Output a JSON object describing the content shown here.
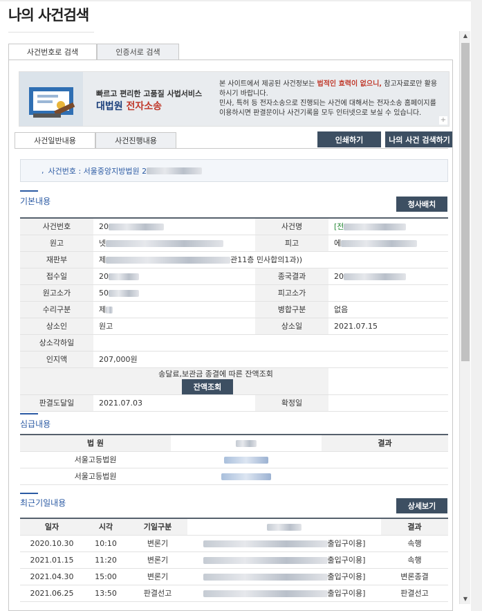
{
  "page_title": "나의 사건검색",
  "tabs_top": [
    "사건번호로 검색",
    "인증서로 검색"
  ],
  "banner": {
    "slogan": "빠르고 편리한 고품질 사법서비스",
    "brand_a": "대법원 ",
    "brand_b": "전자소송",
    "note_1": "본 사이트에서 제공된 사건정보는 ",
    "note_hl": "법적인 효력이 없으니,",
    "note_2": " 참고자료로만 활용하시기 바랍니다.",
    "note_3": "민사, 특허 등 전자소송으로 진행되는 사건에 대해서는 전자소송 홈페이지를 이용하시면 판결문이나 사건기록을 모두 인터넷으로 보실 수 있습니다.",
    "plus": "+"
  },
  "tabs_inner": [
    "사건일반내용",
    "사건진행내용"
  ],
  "buttons": {
    "print": "인쇄하기",
    "my_case": "나의 사건 검색하기",
    "claim": "청사배치",
    "balance": "잔액조회",
    "detail": "상세보기"
  },
  "case_box": {
    "prefix": ",",
    "text": "사건번호 : 서울중앙지방법원 2"
  },
  "sections": {
    "basic": "기본내용",
    "trial": "심급내용",
    "recent": "최근기일내용"
  },
  "basic": {
    "r1": {
      "l1": "사건번호",
      "v1": "20",
      "l2": "사건명",
      "v2": "[전"
    },
    "r2": {
      "l1": "원고",
      "v1": "넷",
      "l2": "피고",
      "v2": "에"
    },
    "r3": {
      "l1": "재판부",
      "v1": "제",
      "tail": "관11층 민사합의1과))"
    },
    "r4": {
      "l1": "접수일",
      "v1": "20",
      "l2": "종국결과",
      "v2": "20"
    },
    "r5": {
      "l1": "원고소가",
      "v1": "50",
      "l2": "피고소가",
      "v2": ""
    },
    "r6": {
      "l1": "수리구분",
      "v1": "제",
      "l2": "병합구분",
      "v2": "없음"
    },
    "r7": {
      "l1": "상소인",
      "v1": "원고",
      "l2": "상소일",
      "v2": "2021.07.15"
    },
    "r8": {
      "l1": "상소각하일",
      "v1": ""
    },
    "r9": {
      "l1": "인지액",
      "v1": "207,000원"
    },
    "r10": {
      "l1": "송달료,보관금 종결에 따른 잔액조회"
    },
    "r11": {
      "l1": "판결도달일",
      "v1": "2021.07.03",
      "l2": "확정일",
      "v2": ""
    }
  },
  "trial": {
    "headers": [
      "법 원",
      "",
      "결과"
    ],
    "rows": [
      {
        "court": "서울고등법원"
      },
      {
        "court": "서울고등법원"
      }
    ]
  },
  "recent": {
    "headers": [
      "일자",
      "시각",
      "기일구분",
      "장소",
      "결과"
    ],
    "rows": [
      {
        "date": "2020.10.30",
        "time": "10:10",
        "kind": "변론기",
        "place_tail": "출입구이용]",
        "result": "속행"
      },
      {
        "date": "2021.01.15",
        "time": "11:20",
        "kind": "변론기",
        "place_tail": "출입구이용]",
        "result": "속행"
      },
      {
        "date": "2021.04.30",
        "time": "15:00",
        "kind": "변론기",
        "place_tail": "출입구이용]",
        "result": "변론종결"
      },
      {
        "date": "2021.06.25",
        "time": "13:50",
        "kind": "판결선고",
        "place_tail": "출입구이용]",
        "result": "판결선고"
      }
    ]
  }
}
